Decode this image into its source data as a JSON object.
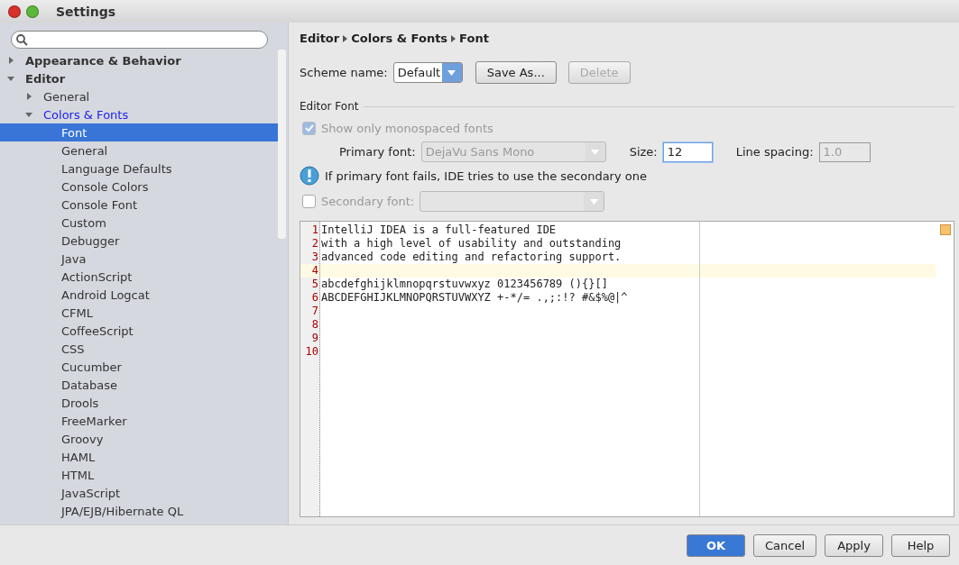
{
  "window": {
    "title": "Settings"
  },
  "tree": [
    {
      "label": "Appearance & Behavior",
      "expanded": false,
      "selected": false
    },
    {
      "label": "Editor",
      "expanded": true,
      "selected": false,
      "children": [
        {
          "label": "General",
          "expanded": false,
          "selected": false
        },
        {
          "label": "Colors & Fonts",
          "expanded": true,
          "selected": false,
          "children": [
            {
              "label": "Font",
              "selected": true
            },
            {
              "label": "General",
              "selected": false
            },
            {
              "label": "Language Defaults",
              "selected": false
            },
            {
              "label": "Console Colors",
              "selected": false
            },
            {
              "label": "Console Font",
              "selected": false
            },
            {
              "label": "Custom",
              "selected": false
            },
            {
              "label": "Debugger",
              "selected": false
            },
            {
              "label": "Java",
              "selected": false
            },
            {
              "label": "ActionScript",
              "selected": false
            },
            {
              "label": "Android Logcat",
              "selected": false
            },
            {
              "label": "CFML",
              "selected": false
            },
            {
              "label": "CoffeeScript",
              "selected": false
            },
            {
              "label": "CSS",
              "selected": false
            },
            {
              "label": "Cucumber",
              "selected": false
            },
            {
              "label": "Database",
              "selected": false
            },
            {
              "label": "Drools",
              "selected": false
            },
            {
              "label": "FreeMarker",
              "selected": false
            },
            {
              "label": "Groovy",
              "selected": false
            },
            {
              "label": "HAML",
              "selected": false
            },
            {
              "label": "HTML",
              "selected": false
            },
            {
              "label": "JavaScript",
              "selected": false
            },
            {
              "label": "JPA/EJB/Hibernate QL",
              "selected": false
            }
          ]
        }
      ]
    }
  ],
  "breadcrumb": [
    "Editor",
    "Colors & Fonts",
    "Font"
  ],
  "scheme": {
    "label": "Scheme name:",
    "value": "Default",
    "buttons": [
      {
        "label": "Save As...",
        "disabled": false
      },
      {
        "label": "Delete",
        "disabled": true
      }
    ]
  },
  "section": "Editor Font",
  "mono_only": {
    "label": "Show only monospaced fonts",
    "checked": true,
    "disabled": true
  },
  "primary": {
    "label": "Primary font:",
    "value": "DejaVu Sans Mono",
    "disabled": true
  },
  "size": {
    "label": "Size:",
    "value": "12"
  },
  "spacing": {
    "label": "Line spacing:",
    "value": "1.0",
    "disabled": true
  },
  "info": "If primary font fails, IDE tries to use the secondary one",
  "secondary": {
    "label": "Secondary font:",
    "checked": false
  },
  "preview": [
    {
      "number": "1",
      "text": "IntelliJ IDEA is a full-featured IDE",
      "current": false
    },
    {
      "number": "2",
      "text": "with a high level of usability and outstanding",
      "current": false
    },
    {
      "number": "3",
      "text": "advanced code editing and refactoring support.",
      "current": false
    },
    {
      "number": "4",
      "current": true
    },
    {
      "number": "5",
      "text": "abcdefghijklmnopqrstuvwxyz 0123456789 (){}[]",
      "current": false
    },
    {
      "number": "6",
      "text": "ABCDEFGHIJKLMNOPQRSTUVWXYZ +-*/= .,;:!? #&$%@|^",
      "current": false
    },
    {
      "number": "7",
      "current": false
    },
    {
      "number": "8",
      "current": false
    },
    {
      "number": "9",
      "current": false
    },
    {
      "number": "10",
      "current": false
    }
  ],
  "footer": [
    {
      "label": "OK",
      "kind": "primary"
    },
    {
      "label": "Cancel",
      "kind": "normal"
    },
    {
      "label": "Apply",
      "kind": "normal"
    },
    {
      "label": "Help",
      "kind": "normal"
    }
  ]
}
